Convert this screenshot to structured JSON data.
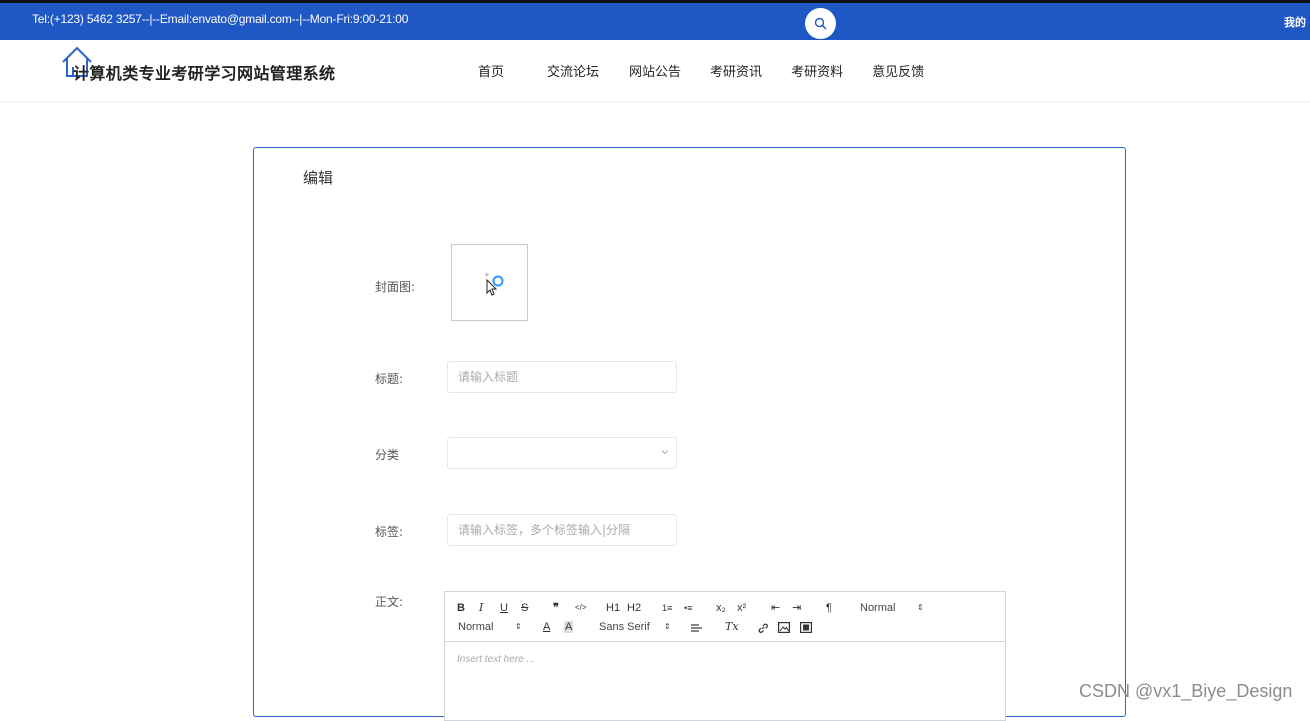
{
  "topbar": {
    "contact": "Tel:(+123) 5462 3257--|--Email:envato@gmail.com--|--Mon-Fri:9:00-21:00",
    "mine": "我的",
    "search_icon": "search-icon",
    "color": "#1f57c5"
  },
  "header": {
    "title": "计算机类专业考研学习网站管理系统",
    "logo_icon": "house-icon",
    "nav": [
      "首页",
      "交流论坛",
      "网站公告",
      "考研资讯",
      "考研资料",
      "意见反馈"
    ]
  },
  "form": {
    "title": "编辑",
    "cover_label": "封面图:",
    "title_label": "标题:",
    "title_placeholder": "请输入标题",
    "category_label": "分类",
    "tags_label": "标签:",
    "tags_placeholder": "请输入标签，多个标签输入|分隔",
    "body_label": "正文:"
  },
  "editor": {
    "toolbar_row1": [
      "B",
      "I",
      "U",
      "S",
      "❞",
      "</>",
      "H1",
      "H2",
      "1≡",
      "•≡",
      "x₂",
      "x²",
      "⇤",
      "⇥",
      "¶",
      "Normal"
    ],
    "toolbar_row2": [
      "Normal",
      "A",
      "A",
      "Sans Serif",
      "align",
      "Tx",
      "link",
      "image",
      "video"
    ],
    "placeholder": "Insert text here ..."
  },
  "watermark": "CSDN @vx1_Biye_Design",
  "colors": {
    "accent": "#2e63c8",
    "upload_blue": "#409eff"
  }
}
